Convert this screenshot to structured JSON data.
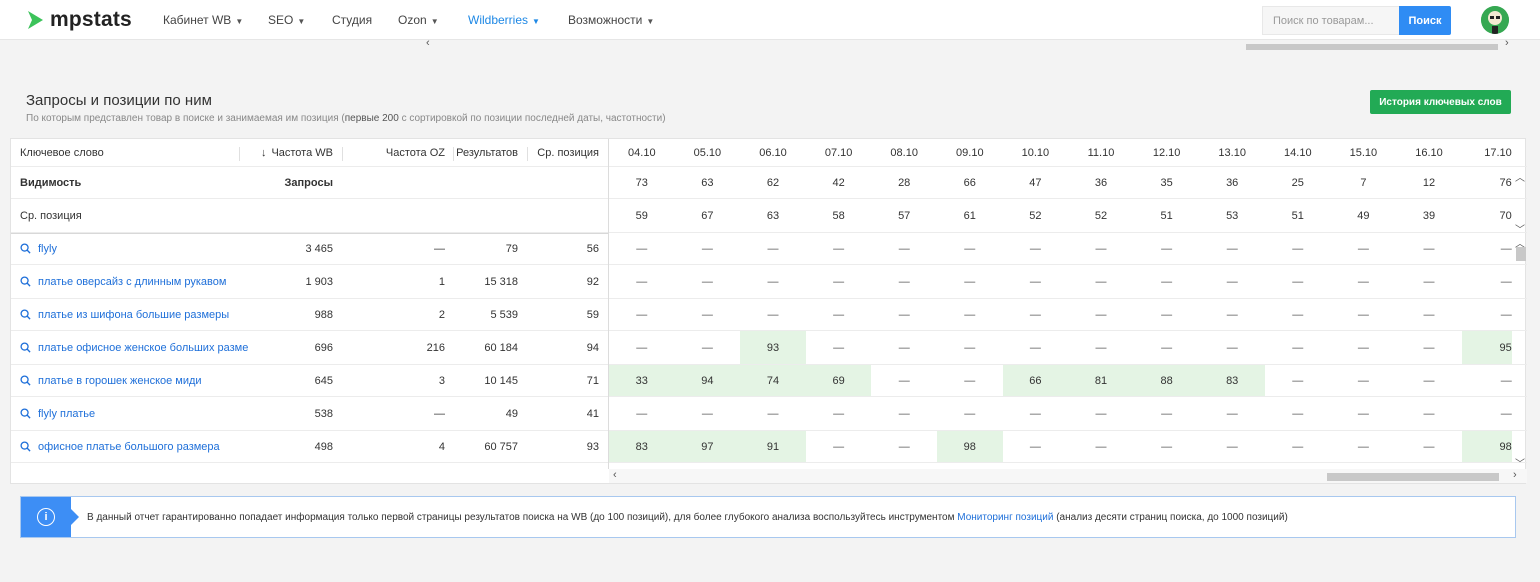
{
  "nav": {
    "logo": "mpstats",
    "items": [
      {
        "label": "Кабинет WB",
        "caret": true,
        "active": false
      },
      {
        "label": "SEO",
        "caret": true,
        "active": false
      },
      {
        "label": "Студия",
        "caret": false,
        "active": false
      },
      {
        "label": "Ozon",
        "caret": true,
        "active": false
      },
      {
        "label": "Wildberries",
        "caret": true,
        "active": true
      },
      {
        "label": "Возможности",
        "caret": true,
        "active": false
      }
    ],
    "search_placeholder": "Поиск по товарам...",
    "search_button": "Поиск"
  },
  "section": {
    "title": "Запросы и позиции по ним",
    "subtitle_pre": "По которым представлен товар в поиске и занимаемая им позиция (",
    "subtitle_bold": "первые 200",
    "subtitle_post": " с сортировкой по позиции последней даты, частотности)",
    "history_button": "История ключевых слов"
  },
  "table": {
    "headers": {
      "keyword": "Ключевое слово",
      "freq_wb": "Частота WB",
      "sort_icon": "↓",
      "freq_oz": "Частота OZ",
      "results": "Результатов",
      "avg_pos": "Ср. позиция"
    },
    "dates": [
      "04.10",
      "05.10",
      "06.10",
      "07.10",
      "08.10",
      "09.10",
      "10.10",
      "11.10",
      "12.10",
      "13.10",
      "14.10",
      "15.10",
      "16.10",
      "17.10"
    ],
    "visibility": {
      "label": "Видимость",
      "freq_label": "Запросы",
      "values": [
        "73",
        "63",
        "62",
        "42",
        "28",
        "66",
        "47",
        "36",
        "35",
        "36",
        "25",
        "7",
        "12",
        "76"
      ]
    },
    "avg_position": {
      "label": "Ср. позиция",
      "values": [
        "59",
        "67",
        "63",
        "58",
        "57",
        "61",
        "52",
        "52",
        "51",
        "53",
        "51",
        "49",
        "39",
        "70"
      ]
    },
    "rows": [
      {
        "keyword": "flyly",
        "freq_wb": "3 465",
        "freq_oz": "—",
        "results": "79",
        "avg_pos": "56",
        "positions": [
          "—",
          "—",
          "—",
          "—",
          "—",
          "—",
          "—",
          "—",
          "—",
          "—",
          "—",
          "—",
          "—",
          "—"
        ]
      },
      {
        "keyword": "платье оверсайз с длинным рукавом",
        "freq_wb": "1 903",
        "freq_oz": "1",
        "results": "15 318",
        "avg_pos": "92",
        "positions": [
          "—",
          "—",
          "—",
          "—",
          "—",
          "—",
          "—",
          "—",
          "—",
          "—",
          "—",
          "—",
          "—",
          "—"
        ]
      },
      {
        "keyword": "платье из шифона большие размеры",
        "freq_wb": "988",
        "freq_oz": "2",
        "results": "5 539",
        "avg_pos": "59",
        "positions": [
          "—",
          "—",
          "—",
          "—",
          "—",
          "—",
          "—",
          "—",
          "—",
          "—",
          "—",
          "—",
          "—",
          "—"
        ]
      },
      {
        "keyword": "платье офисное женское больших разме",
        "freq_wb": "696",
        "freq_oz": "216",
        "results": "60 184",
        "avg_pos": "94",
        "positions": [
          "—",
          "—",
          "93",
          "—",
          "—",
          "—",
          "—",
          "—",
          "—",
          "—",
          "—",
          "—",
          "—",
          "95"
        ]
      },
      {
        "keyword": "платье в горошек женское миди",
        "freq_wb": "645",
        "freq_oz": "3",
        "results": "10 145",
        "avg_pos": "71",
        "positions": [
          "33",
          "94",
          "74",
          "69",
          "—",
          "—",
          "66",
          "81",
          "88",
          "83",
          "—",
          "—",
          "—",
          "—"
        ]
      },
      {
        "keyword": "flyly платье",
        "freq_wb": "538",
        "freq_oz": "—",
        "results": "49",
        "avg_pos": "41",
        "positions": [
          "—",
          "—",
          "—",
          "—",
          "—",
          "—",
          "—",
          "—",
          "—",
          "—",
          "—",
          "—",
          "—",
          "—"
        ]
      },
      {
        "keyword": "офисное платье большого размера",
        "freq_wb": "498",
        "freq_oz": "4",
        "results": "60 757",
        "avg_pos": "93",
        "positions": [
          "83",
          "97",
          "91",
          "—",
          "—",
          "98",
          "—",
          "—",
          "—",
          "—",
          "—",
          "—",
          "—",
          "98"
        ]
      }
    ]
  },
  "info": {
    "text_pre": "В данный отчет гарантированно попадает информация только первой страницы результатов поиска на WB (до 100 позиций), для более глубокого анализа воспользуйтесь инструментом ",
    "link": "Мониторинг позиций",
    "text_post": " (анализ десяти страниц поиска, до 1000 позиций)"
  },
  "colors": {
    "accent_blue": "#2f8cf4",
    "link_blue": "#1e6fd9",
    "green_button": "#22aa55",
    "highlight_green": "#e4f4e4"
  }
}
